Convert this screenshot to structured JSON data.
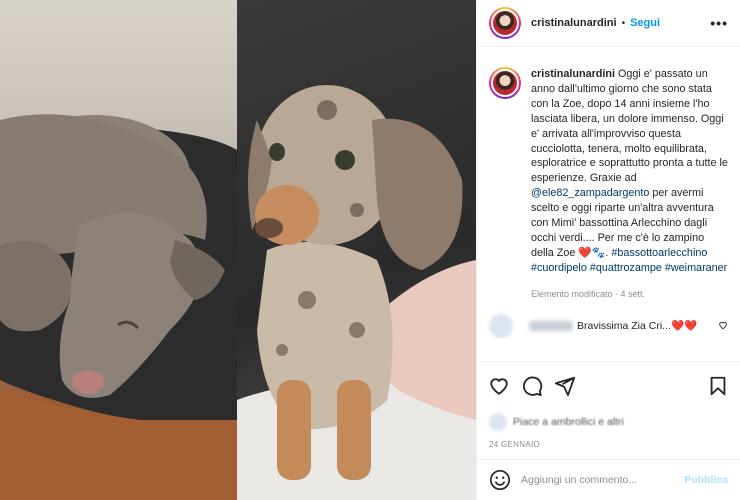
{
  "header": {
    "username": "cristinalunardini",
    "separator": "•",
    "follow_label": "Segui",
    "more_label": "•••"
  },
  "caption": {
    "username": "cristinalunardini",
    "text_part1": " Oggi e' passato un anno dall'ultimo giorno che sono stata con la Zoe, dopo 14 anni insieme l'ho lasciata libera, un dolore immenso. Oggi e' arrivata all'improvviso questa cucciolotta, tenera, molto equilibrata, esploratrice e soprattutto pronta a tutte le esperienze. Graxie ad ",
    "mention": "@ele82_zampadargento",
    "text_part2": " per avermi scelto e oggi riparte un'altra avventura con Mimi' bassottina Arlecchino dagli occhi verdi.... Per me c'è lo zampino della Zoe ",
    "emoji": "❤️🐾.",
    "hashtag1": "#bassottoarlecchino",
    "hashtag2": "#cuordipelo",
    "hashtag3": "#quattrozampe",
    "hashtag4": "#weimaraner",
    "meta": "Elemento modificato · 4 sett."
  },
  "comment": {
    "text": "Bravissima Zia Cri...",
    "hearts": "❤️❤️",
    "like_icon": "heart-outline-icon"
  },
  "actions": {
    "icons": [
      "heart-icon",
      "comment-icon",
      "share-icon",
      "bookmark-icon"
    ]
  },
  "likes": {
    "text": "Piace a ambrollici e altri"
  },
  "date": "24 GENNAIO",
  "add_comment": {
    "placeholder": "Aggiungi un commento...",
    "publish_label": "Pubblica"
  },
  "colors": {
    "follow": "#0095f6",
    "link": "#00376b",
    "muted": "#8e8e8e",
    "publish_disabled": "#b2dffc"
  }
}
